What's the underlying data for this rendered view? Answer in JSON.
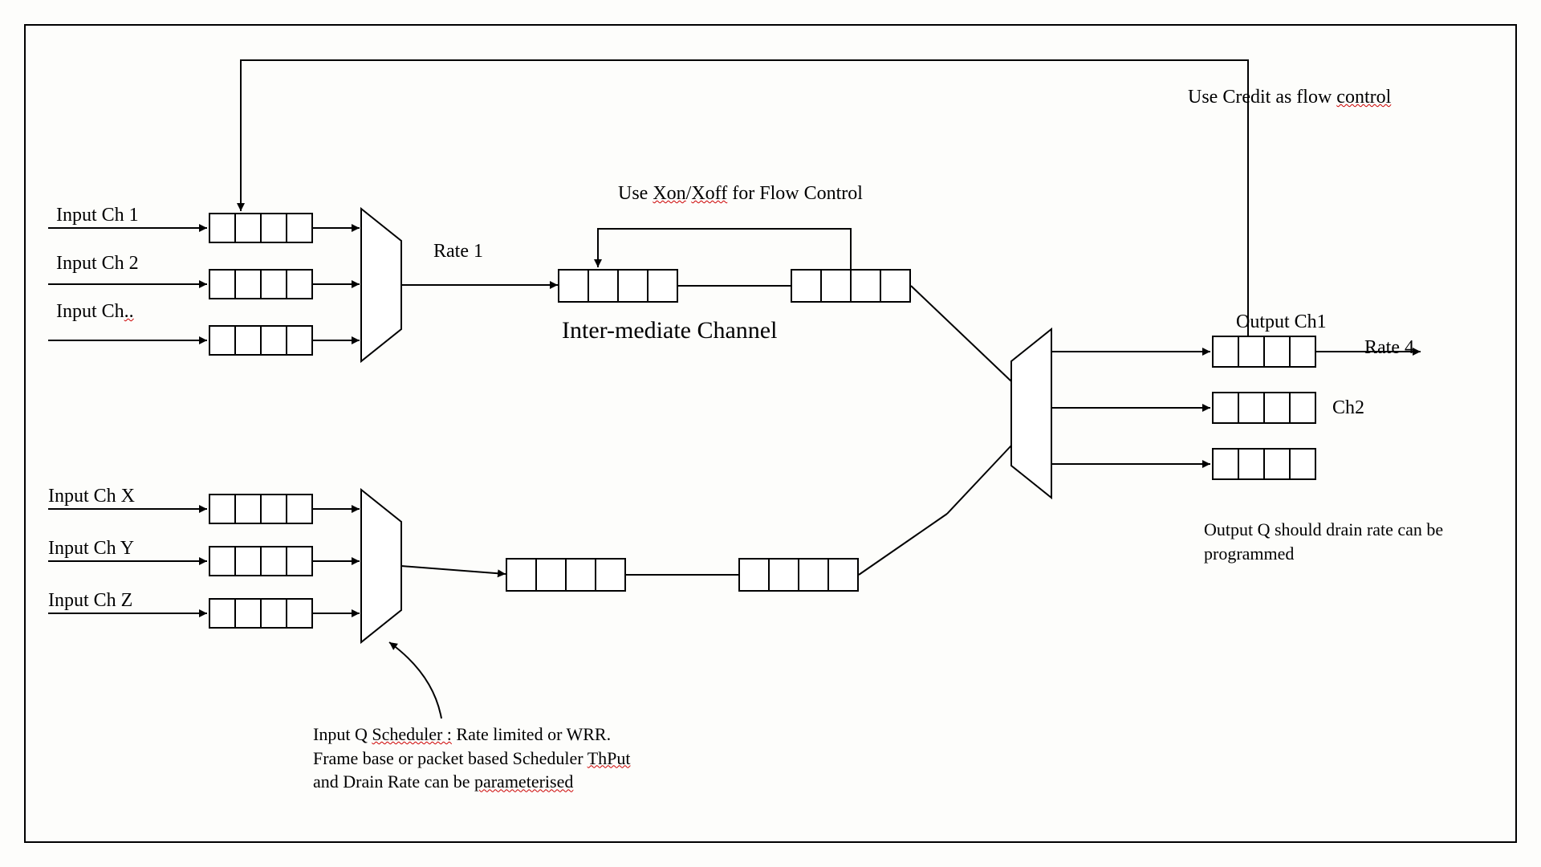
{
  "inputs_top": {
    "ch1": "Input Ch 1",
    "ch2": "Input Ch 2",
    "ch3": "Input Ch"
  },
  "inputs_bottom": {
    "chx": "Input Ch X",
    "chy": "Input Ch Y",
    "chz": "Input Ch Z"
  },
  "labels": {
    "rate1": "Rate 1",
    "xon_xoff": "Use Xon/Xoff for Flow Control",
    "intermediate": "Inter-mediate Channel",
    "credit_flow": "Use Credit as flow control",
    "output_ch1": "Output Ch1",
    "rate4": "Rate 4",
    "ch2": "Ch2",
    "output_note": "Output Q should drain rate can be programmed",
    "scheduler_note": "Input Q Scheduler : Rate limited or WRR. Frame base or packet based Scheduler ThPut and Drain Rate can be parameterised"
  }
}
